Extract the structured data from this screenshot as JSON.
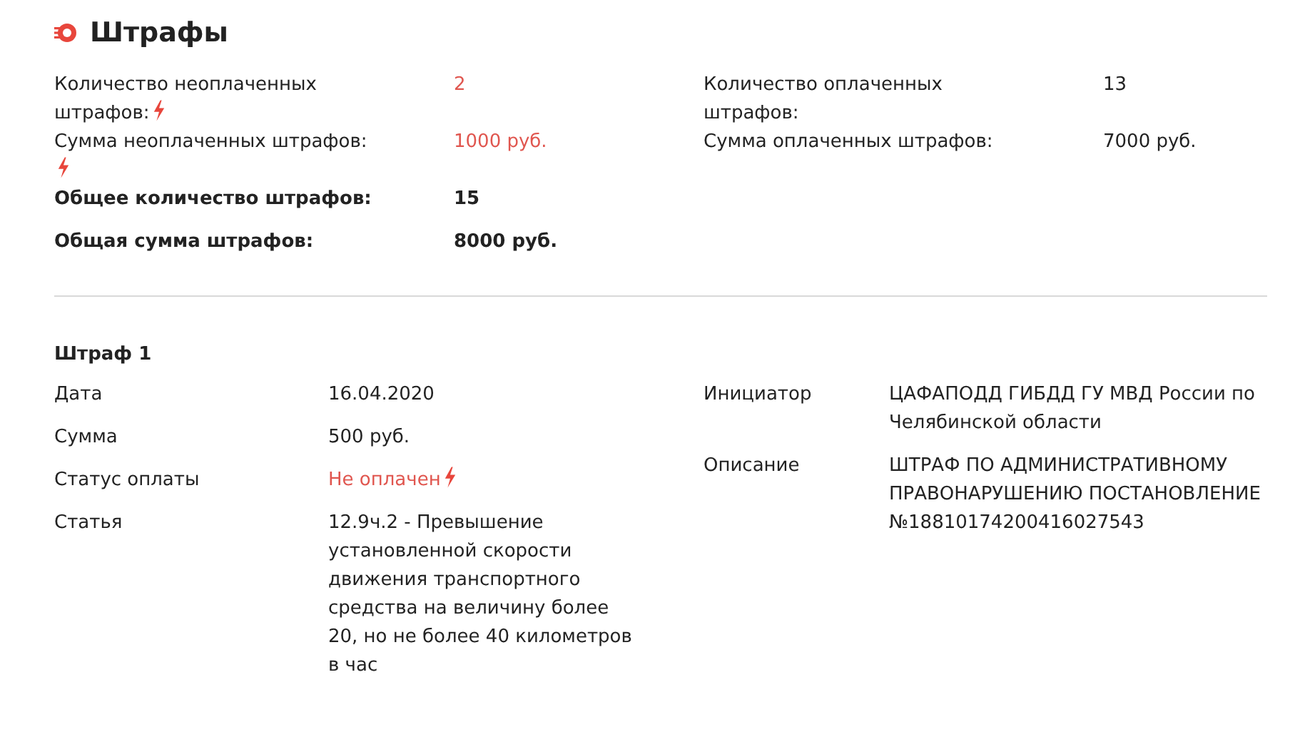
{
  "title": "Штрафы",
  "summary_left": [
    {
      "label": "Количество неоплаченных штрафов:",
      "value": "2",
      "kind": "unpaid"
    },
    {
      "label": "Сумма неоплаченных штрафов:",
      "value": "1000 руб.",
      "kind": "unpaid"
    },
    {
      "label": "Общее количество штрафов:",
      "value": "15",
      "kind": "total"
    },
    {
      "label": "Общая сумма штрафов:",
      "value": "8000 руб.",
      "kind": "total"
    }
  ],
  "summary_right": [
    {
      "label": "Количество оплаченных штрафов:",
      "value": "13"
    },
    {
      "label": "Сумма оплаченных штрафов:",
      "value": "7000 руб."
    }
  ],
  "fines": [
    {
      "title": "Штраф 1",
      "left": [
        {
          "label": "Дата",
          "value": "16.04.2020",
          "kind": "plain"
        },
        {
          "label": "Сумма",
          "value": "500 руб.",
          "kind": "plain"
        },
        {
          "label": "Статус оплаты",
          "value": "Не оплачен",
          "kind": "unpaid"
        },
        {
          "label": "Статья",
          "value": "12.9ч.2 - Превышение установленной скорости движения транспортного средства на величину более 20, но не более 40 километров в час",
          "kind": "plain"
        }
      ],
      "right": [
        {
          "label": "Инициатор",
          "value": "ЦАФАПОДД ГИБДД ГУ МВД России по Челябинской области"
        },
        {
          "label": "Описание",
          "value": "ШТРАФ ПО АДМИНИСТРАТИВНОМУ ПРАВОНАРУШЕНИЮ ПОСТАНОВЛЕНИЕ №18810174200416027543"
        }
      ]
    }
  ]
}
